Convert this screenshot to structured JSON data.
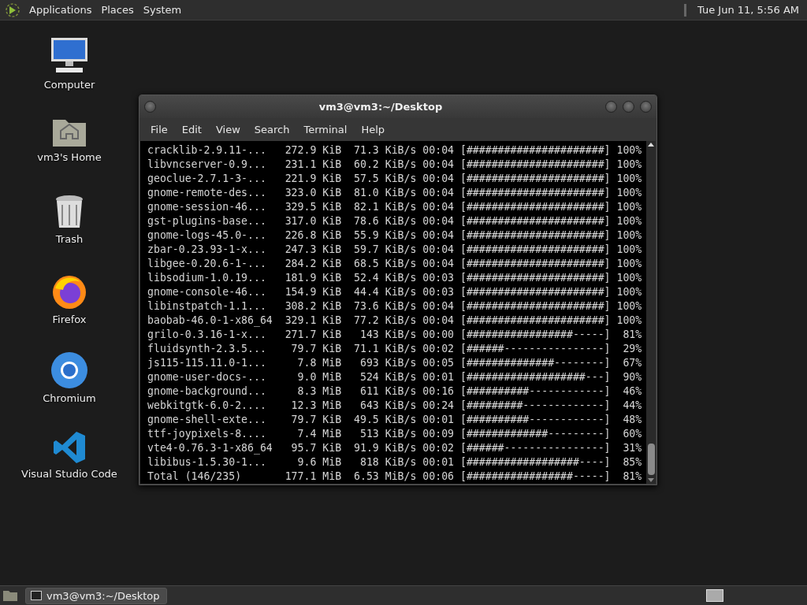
{
  "top_panel": {
    "menus": [
      "Applications",
      "Places",
      "System"
    ],
    "clock": "Tue Jun 11, 5:56 AM"
  },
  "desktop_icons": [
    {
      "label": "Computer",
      "kind": "computer"
    },
    {
      "label": "vm3's Home",
      "kind": "home"
    },
    {
      "label": "Trash",
      "kind": "trash"
    },
    {
      "label": "Firefox",
      "kind": "firefox"
    },
    {
      "label": "Chromium",
      "kind": "chromium"
    },
    {
      "label": "Visual Studio Code",
      "kind": "vscode"
    }
  ],
  "terminal": {
    "title": "vm3@vm3:~/Desktop",
    "menu": [
      "File",
      "Edit",
      "View",
      "Search",
      "Terminal",
      "Help"
    ],
    "lines": [
      "cracklib-2.9.11-...   272.9 KiB  71.3 KiB/s 00:04 [######################] 100%",
      "libvncserver-0.9...   231.1 KiB  60.2 KiB/s 00:04 [######################] 100%",
      "geoclue-2.7.1-3-...   221.9 KiB  57.5 KiB/s 00:04 [######################] 100%",
      "gnome-remote-des...   323.0 KiB  81.0 KiB/s 00:04 [######################] 100%",
      "gnome-session-46...   329.5 KiB  82.1 KiB/s 00:04 [######################] 100%",
      "gst-plugins-base...   317.0 KiB  78.6 KiB/s 00:04 [######################] 100%",
      "gnome-logs-45.0-...   226.8 KiB  55.9 KiB/s 00:04 [######################] 100%",
      "zbar-0.23.93-1-x...   247.3 KiB  59.7 KiB/s 00:04 [######################] 100%",
      "libgee-0.20.6-1-...   284.2 KiB  68.5 KiB/s 00:04 [######################] 100%",
      "libsodium-1.0.19...   181.9 KiB  52.4 KiB/s 00:03 [######################] 100%",
      "gnome-console-46...   154.9 KiB  44.4 KiB/s 00:03 [######################] 100%",
      "libinstpatch-1.1...   308.2 KiB  73.6 KiB/s 00:04 [######################] 100%",
      "baobab-46.0-1-x86_64  329.1 KiB  77.2 KiB/s 00:04 [######################] 100%",
      "grilo-0.3.16-1-x...   271.7 KiB   143 KiB/s 00:00 [#################-----]  81%",
      "fluidsynth-2.3.5...    79.7 KiB  71.1 KiB/s 00:02 [######----------------]  29%",
      "js115-115.11.0-1...     7.8 MiB   693 KiB/s 00:05 [##############--------]  67%",
      "gnome-user-docs-...     9.0 MiB   524 KiB/s 00:01 [###################---]  90%",
      "gnome-background...     8.3 MiB   611 KiB/s 00:16 [##########------------]  46%",
      "webkitgtk-6.0-2....    12.3 MiB   643 KiB/s 00:24 [#########-------------]  44%",
      "gnome-shell-exte...    79.7 KiB  49.5 KiB/s 00:01 [##########------------]  48%",
      "ttf-joypixels-8....     7.4 MiB   513 KiB/s 00:09 [#############---------]  60%",
      "vte4-0.76.3-1-x86_64   95.7 KiB  91.9 KiB/s 00:02 [######----------------]  31%",
      "libibus-1.5.30-1...     9.6 MiB   818 KiB/s 00:01 [##################----]  85%",
      "Total (146/235)       177.1 MiB  6.53 MiB/s 00:06 [#################-----]  81%"
    ]
  },
  "taskbar": {
    "tasks": [
      {
        "label": "vm3@vm3:~/Desktop",
        "selected": true
      }
    ]
  }
}
